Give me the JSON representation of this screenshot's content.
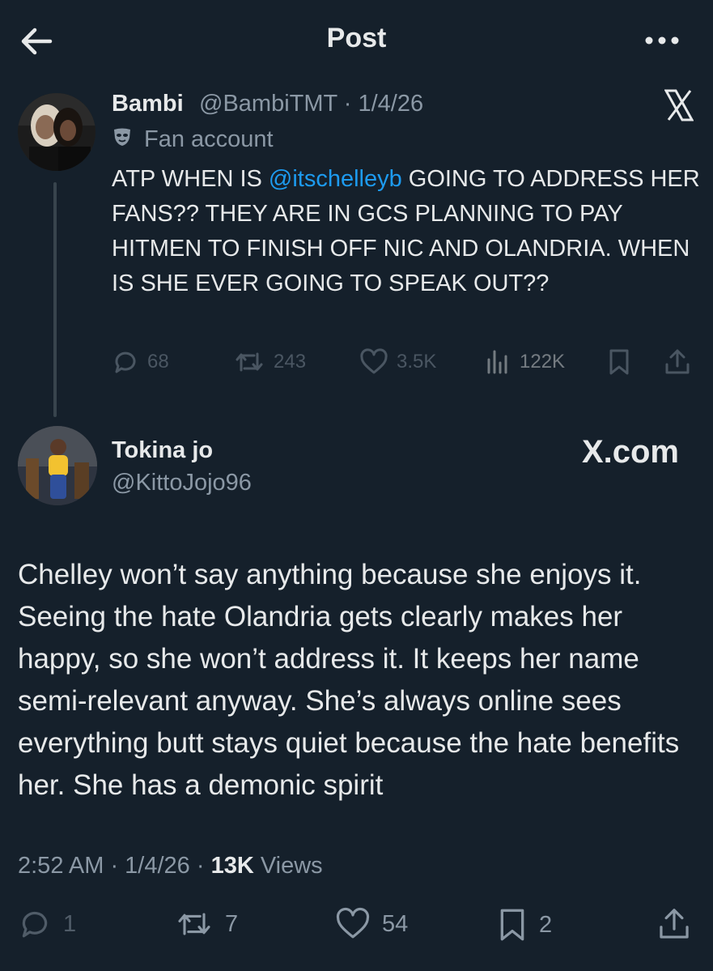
{
  "header": {
    "title": "Post",
    "back_icon": "arrow-left-icon",
    "more_icon": "more-horizontal-icon"
  },
  "quoted_post": {
    "display_name": "Bambi",
    "meta": "@BambiTMT · 1/4/26",
    "label": "Fan account",
    "label_icon": "mask-icon",
    "text_before": "ATP WHEN IS ",
    "mention": "@itschelleyb",
    "text_after": " GOING TO ADDRESS HER FANS?? THEY ARE IN GCS PLANNING TO PAY HITMEN TO FINISH OFF NIC AND OLANDRIA. WHEN IS SHE EVER GOING TO SPEAK OUT??",
    "replies": "68",
    "reposts": "243",
    "likes": "3.5K",
    "views": "122K"
  },
  "reply_post": {
    "display_name": "Tokina jo",
    "handle": "@KittoJojo96",
    "watermark": "X.com",
    "text": "Chelley won’t say anything because she enjoys it. Seeing the hate Olandria gets clearly makes her happy, so she won’t address it. It keeps her name semi-relevant anyway. She’s always online sees everything butt stays quiet because the hate benefits her. She has a demonic spirit",
    "time": "2:52 AM · 1/4/26 · ",
    "views_count": "13K",
    "views_label": " Views",
    "replies": "1",
    "reposts": "7",
    "likes": "54",
    "bookmarks": "2"
  },
  "colors": {
    "background": "#15202b",
    "text": "#e7e9ea",
    "muted": "#8b98a5",
    "link": "#1d9bf0"
  }
}
